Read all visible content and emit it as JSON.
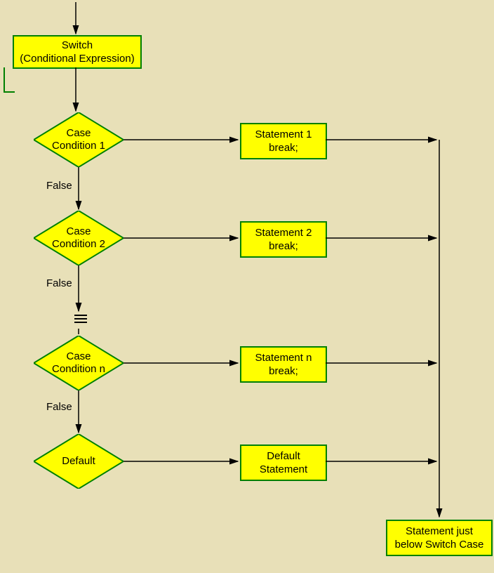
{
  "switch_box": {
    "line1": "Switch",
    "line2": "(Conditional Expression)"
  },
  "cases": [
    {
      "title1": "Case",
      "title2": "Condition 1",
      "stmt1": "Statement 1",
      "stmt2": "break;",
      "false": "False"
    },
    {
      "title1": "Case",
      "title2": "Condition 2",
      "stmt1": "Statement 2",
      "stmt2": "break;",
      "false": "False"
    },
    {
      "title1": "Case",
      "title2": "Condition n",
      "stmt1": "Statement n",
      "stmt2": "break;",
      "false": "False"
    }
  ],
  "default": {
    "title": "Default",
    "stmt1": "Default",
    "stmt2": "Statement"
  },
  "final": {
    "line1": "Statement just",
    "line2": "below Switch Case"
  },
  "chart_data": {
    "type": "flowchart",
    "nodes": [
      {
        "id": "switch",
        "type": "process",
        "label": "Switch (Conditional Expression)"
      },
      {
        "id": "c1",
        "type": "decision",
        "label": "Case Condition 1"
      },
      {
        "id": "s1",
        "type": "process",
        "label": "Statement 1 break;"
      },
      {
        "id": "c2",
        "type": "decision",
        "label": "Case Condition 2"
      },
      {
        "id": "s2",
        "type": "process",
        "label": "Statement 2 break;"
      },
      {
        "id": "cn",
        "type": "decision",
        "label": "Case Condition n"
      },
      {
        "id": "sn",
        "type": "process",
        "label": "Statement n break;"
      },
      {
        "id": "def",
        "type": "decision",
        "label": "Default"
      },
      {
        "id": "sdef",
        "type": "process",
        "label": "Default Statement"
      },
      {
        "id": "end",
        "type": "process",
        "label": "Statement just below Switch Case"
      }
    ],
    "edges": [
      {
        "from": "switch",
        "to": "c1"
      },
      {
        "from": "c1",
        "to": "s1",
        "label": ""
      },
      {
        "from": "c1",
        "to": "c2",
        "label": "False"
      },
      {
        "from": "c2",
        "to": "s2",
        "label": ""
      },
      {
        "from": "c2",
        "to": "cn",
        "label": "False"
      },
      {
        "from": "cn",
        "to": "sn",
        "label": ""
      },
      {
        "from": "cn",
        "to": "def",
        "label": "False"
      },
      {
        "from": "def",
        "to": "sdef",
        "label": ""
      },
      {
        "from": "s1",
        "to": "end"
      },
      {
        "from": "s2",
        "to": "end"
      },
      {
        "from": "sn",
        "to": "end"
      },
      {
        "from": "sdef",
        "to": "end"
      }
    ]
  }
}
